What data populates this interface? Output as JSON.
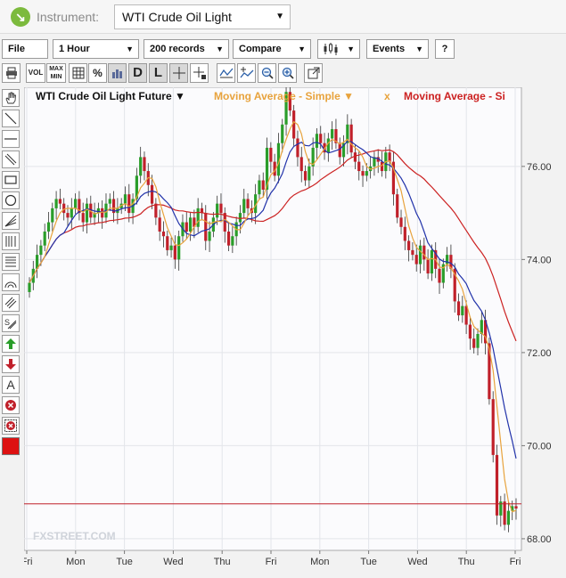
{
  "header": {
    "instrument_label": "Instrument:",
    "instrument_value": "WTI Crude Oil Light",
    "logo_icon": "arrow-down-right-icon"
  },
  "toolbar": {
    "file": "File",
    "timeframe": "1 Hour",
    "records": "200 records",
    "compare": "Compare",
    "chart_type_icon": "candlestick-icon",
    "events": "Events",
    "help": "?"
  },
  "tools": {
    "vol": "VOL",
    "maxmin_top": "MAX",
    "maxmin_bottom": "MIN",
    "d": "D",
    "l": "L",
    "percent": "%"
  },
  "sidebar_icons": [
    "hand-icon",
    "line-icon",
    "horizontal-line-icon",
    "parallel-lines-icon",
    "rectangle-icon",
    "circle-icon",
    "fan-icon",
    "fibonacci-icon",
    "fibonacci-levels-icon",
    "arc-icon",
    "channel-icon",
    "regression-icon",
    "arrow-up-icon",
    "arrow-down-icon",
    "text-icon",
    "delete-icon",
    "delete-all-icon",
    "color-icon"
  ],
  "chart_data": {
    "type": "candlestick",
    "title": "WTI Crude Oil Light Future",
    "indicators": [
      {
        "name": "Moving Average - Simple",
        "color": "#e8a33d"
      },
      {
        "name": "Moving Average - Si",
        "color": "#cc2222"
      }
    ],
    "x_labels": [
      "Fri",
      "Mon",
      "Tue",
      "Wed",
      "Thu",
      "Fri",
      "Mon",
      "Tue",
      "Wed",
      "Thu",
      "Fri"
    ],
    "y_ticks": [
      "76.00",
      "74.00",
      "72.00",
      "70.00",
      "68.00"
    ],
    "ylim": [
      67.75,
      77.7
    ],
    "hline": 68.75,
    "watermark": "FXSTREET.COM",
    "colors": {
      "up": "#2a9d2a",
      "down": "#c0202a",
      "ma_fast": "#e8a33d",
      "ma_mid": "#2233aa",
      "ma_slow": "#cc2222",
      "hline": "#c0202a"
    },
    "close": [
      73.5,
      73.8,
      74.1,
      74.3,
      74.6,
      74.8,
      75.1,
      75.3,
      75.2,
      75.0,
      74.9,
      75.1,
      75.3,
      75.0,
      74.8,
      75.2,
      74.9,
      75.0,
      75.1,
      74.9,
      75.2,
      75.3,
      75.0,
      75.1,
      75.2,
      75.4,
      75.0,
      75.3,
      75.8,
      76.2,
      75.9,
      75.6,
      75.2,
      74.9,
      74.6,
      74.5,
      74.2,
      74.3,
      74.0,
      74.5,
      74.8,
      74.6,
      74.9,
      74.7,
      75.1,
      75.0,
      74.4,
      74.6,
      74.9,
      75.2,
      75.0,
      74.6,
      74.3,
      74.5,
      74.8,
      75.0,
      75.3,
      75.1,
      75.0,
      75.4,
      75.7,
      75.5,
      76.4,
      76.1,
      75.8,
      76.5,
      76.9,
      77.6,
      77.2,
      76.6,
      76.2,
      75.9,
      75.7,
      76.0,
      76.4,
      76.7,
      76.5,
      76.3,
      76.6,
      76.8,
      76.5,
      76.2,
      76.5,
      76.9,
      76.3,
      76.1,
      75.9,
      75.8,
      75.9,
      76.0,
      76.2,
      76.1,
      75.9,
      76.3,
      76.1,
      75.4,
      74.9,
      74.7,
      74.4,
      74.2,
      74.1,
      73.9,
      74.3,
      74.0,
      73.7,
      74.2,
      73.8,
      73.5,
      73.9,
      74.1,
      73.8,
      73.1,
      72.8,
      73.0,
      72.6,
      72.3,
      72.1,
      72.4,
      72.7,
      72.2,
      71.0,
      69.8,
      68.5,
      68.8,
      68.3,
      68.6,
      68.7,
      68.65
    ]
  }
}
